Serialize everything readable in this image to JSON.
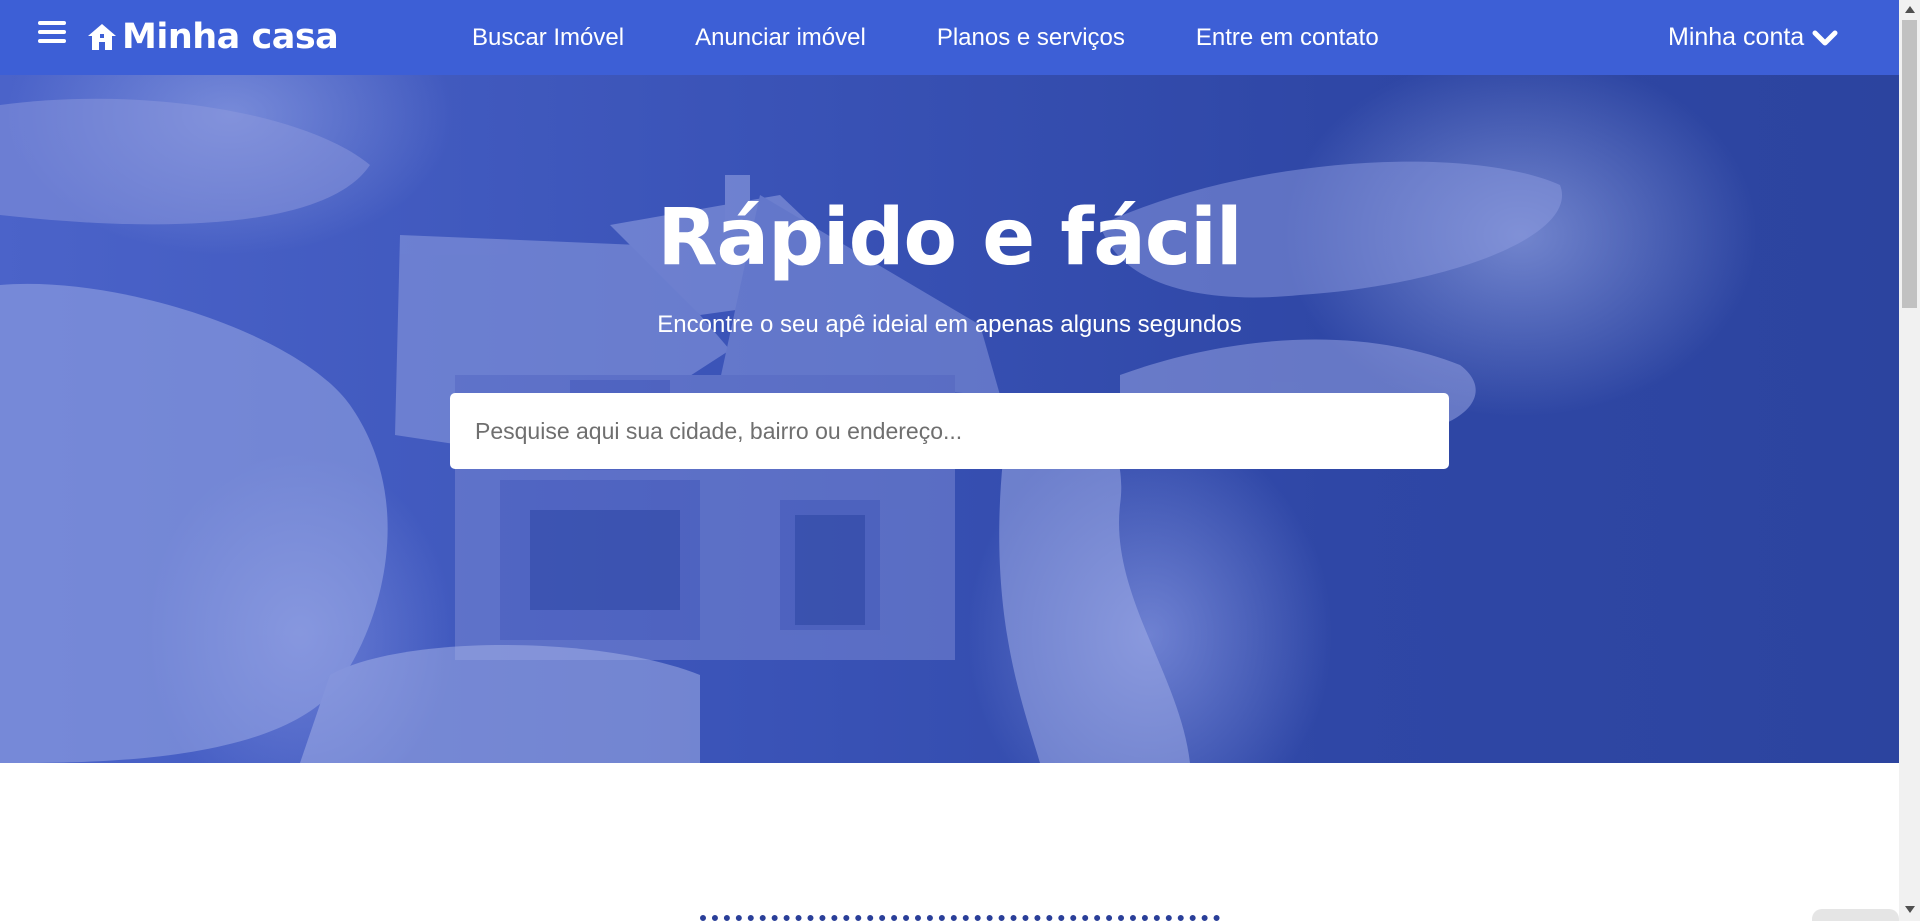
{
  "navbar": {
    "brand": "Minha casa",
    "menu_icon": "hamburger-menu-icon",
    "logo_icon": "house-icon",
    "links": [
      {
        "label": "Buscar Imóvel"
      },
      {
        "label": "Anunciar imóvel"
      },
      {
        "label": "Planos e serviços"
      },
      {
        "label": "Entre em contato"
      }
    ],
    "account": {
      "label": "Minha conta",
      "icon": "chevron-down-icon"
    }
  },
  "hero": {
    "title": "Rápido e fácil",
    "subtitle": "Encontre o seu apê ideial em apenas alguns segundos",
    "search_placeholder": "Pesquise aqui sua cidade, bairro ou endereço..."
  },
  "colors": {
    "primary": "#3d5fd6",
    "hero_overlay": "#3a53b7",
    "text_light": "#ffffff"
  }
}
